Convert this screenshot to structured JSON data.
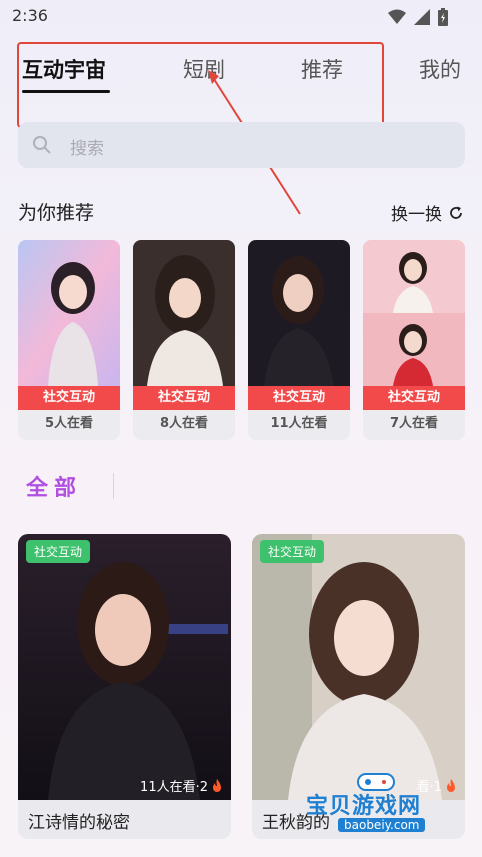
{
  "status": {
    "time": "2:36"
  },
  "tabs": [
    {
      "label": "互动宇宙",
      "active": true
    },
    {
      "label": "短剧",
      "active": false
    },
    {
      "label": "推荐",
      "active": false
    },
    {
      "label": "我的",
      "active": false
    }
  ],
  "search": {
    "placeholder": "搜索"
  },
  "recommend": {
    "title": "为你推荐",
    "refresh_label": "换一换",
    "cards": [
      {
        "tag": "社交互动",
        "views": "5人在看"
      },
      {
        "tag": "社交互动",
        "views": "8人在看"
      },
      {
        "tag": "社交互动",
        "views": "11人在看"
      },
      {
        "tag": "社交互动",
        "views": "7人在看"
      }
    ]
  },
  "all_section": {
    "title": "全部"
  },
  "feed": [
    {
      "tag": "社交互动",
      "views": "11人在看·2",
      "name": "江诗情的秘密"
    },
    {
      "tag": "社交互动",
      "views": "看·1",
      "name": "王秋韵的"
    }
  ],
  "watermark": {
    "text": "宝贝游戏网",
    "url": "baobeiy.com"
  },
  "colors": {
    "accent_purple": "#b04fe0",
    "tag_red": "#f24a4a",
    "tag_green": "#3ec16d",
    "annotation_red": "#e0463a"
  }
}
